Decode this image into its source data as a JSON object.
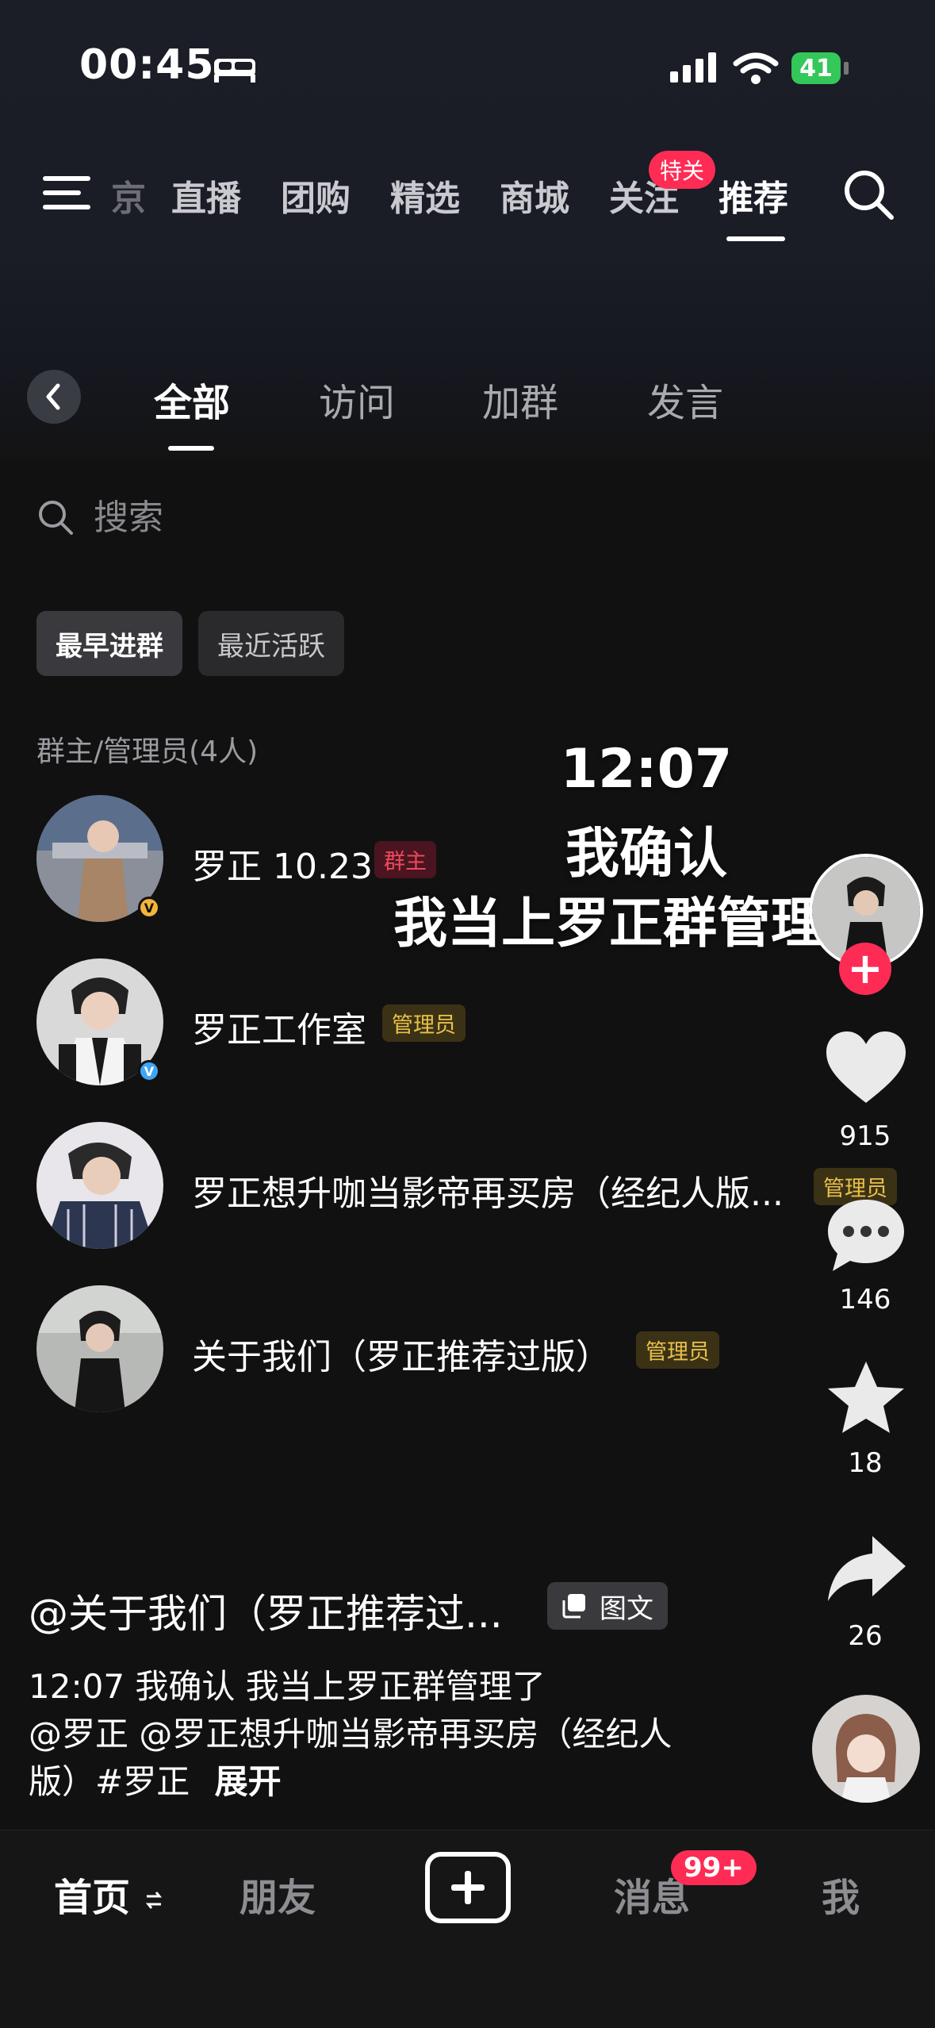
{
  "status_bar": {
    "time": "00:45",
    "battery": "41"
  },
  "top_nav": {
    "partial_item": "京",
    "items": [
      "直播",
      "团购",
      "精选",
      "商城",
      "关注",
      "推荐"
    ],
    "active": "推荐",
    "follow_badge": "特关"
  },
  "sub_tabs": {
    "items": [
      "全部",
      "访问",
      "加群",
      "发言"
    ],
    "active": "全部"
  },
  "search": {
    "placeholder": "搜索"
  },
  "filters": [
    {
      "label": "最早进群",
      "active": true
    },
    {
      "label": "最近活跃",
      "active": false
    }
  ],
  "section_label": "群主/管理员(4人)",
  "members": [
    {
      "name": "罗正 10.23",
      "role": "群主",
      "verified": true,
      "verify_color": "gold"
    },
    {
      "name": "罗正工作室",
      "role": "管理员",
      "verified": true,
      "verify_color": "blue"
    },
    {
      "name": "罗正想升咖当影帝再买房（经纪人版...",
      "role": "管理员",
      "verified": false
    },
    {
      "name": "关于我们（罗正推荐过版）",
      "role": "管理员",
      "verified": false
    }
  ],
  "overlay_caption": [
    "12:07",
    "我确认",
    "我当上罗正群管理"
  ],
  "right_rail": {
    "likes": "915",
    "comments": "146",
    "favorites": "18",
    "shares": "26"
  },
  "post": {
    "author": "@关于我们（罗正推荐过...",
    "type_label": "图文",
    "desc_line1": "12:07 我确认 我当上罗正群管理了",
    "desc_line2": "@罗正 @罗正想升咖当影帝再买房（经纪人",
    "desc_line3": "版）#罗正",
    "expand": "展开"
  },
  "bottom_nav": {
    "home": "首页",
    "friends": "朋友",
    "messages": "消息",
    "messages_badge": "99+",
    "me": "我"
  },
  "colors": {
    "accent": "#fe2c55",
    "owner_badge": "#f0485c",
    "admin_badge": "#e9c04a",
    "battery": "#34c759"
  }
}
